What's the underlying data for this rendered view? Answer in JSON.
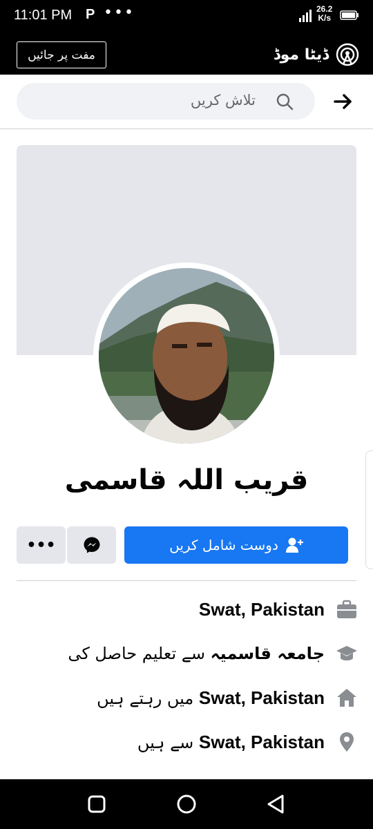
{
  "status_bar": {
    "time": "11:01 PM",
    "app_icon": "P",
    "more": "•••",
    "speed_value": "26.2",
    "speed_unit": "K/s"
  },
  "data_bar": {
    "free_button": "مفت پر جائیں",
    "mode_label": "ڈیٹا موڈ"
  },
  "search": {
    "placeholder": "تلاش کریں"
  },
  "profile": {
    "name": "قریب اللہ قاسمی",
    "add_friend_label": "دوست شامل کریں",
    "more_label": "•••"
  },
  "info": {
    "work": {
      "bold": "Swat, Pakistan",
      "rest": ""
    },
    "education": {
      "bold": "جامعہ قاسمیہ",
      "rest": " سے تعلیم حاصل کی"
    },
    "lives": {
      "bold": "Swat, Pakistan",
      "rest": " میں رہتے ہیں"
    },
    "from": {
      "bold": "Swat, Pakistan",
      "rest": " سے ہیں"
    }
  },
  "icons": {
    "signal": "signal-icon",
    "battery": "battery-icon",
    "data_mode": "radio-tower-icon",
    "search": "search-icon",
    "arrow": "arrow-right-icon",
    "add_friend": "add-friend-icon",
    "messenger": "messenger-icon",
    "work": "briefcase-icon",
    "education": "graduation-cap-icon",
    "lives": "home-icon",
    "from": "location-pin-icon"
  },
  "colors": {
    "accent": "#1877f2",
    "secondary_button": "#e4e6eb",
    "icon_gray": "#8a8d91",
    "text": "#050505"
  }
}
